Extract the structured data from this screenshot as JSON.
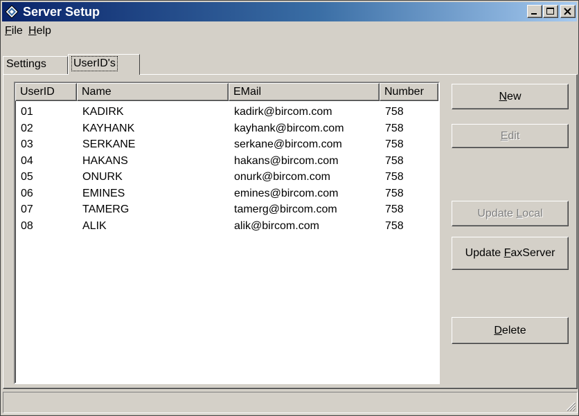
{
  "window": {
    "title": "Server Setup"
  },
  "titlebar_buttons": {
    "minimize": "minimize-icon",
    "maximize": "maximize-icon",
    "close": "close-icon"
  },
  "menu": [
    {
      "label": "File",
      "accel": "F",
      "rest": "ile"
    },
    {
      "label": "Help",
      "accel": "H",
      "rest": "elp"
    }
  ],
  "tabs": [
    {
      "label": "Settings",
      "selected": false
    },
    {
      "label": "UserID's",
      "selected": true
    }
  ],
  "table": {
    "columns": [
      "UserID",
      "Name",
      "EMail",
      "Number"
    ],
    "rows": [
      [
        "01",
        "KADIRK",
        "kadirk@bircom.com",
        "758"
      ],
      [
        "02",
        "KAYHANK",
        "kayhank@bircom.com",
        "758"
      ],
      [
        "03",
        "SERKANE",
        "serkane@bircom.com",
        "758"
      ],
      [
        "04",
        "HAKANS",
        "hakans@bircom.com",
        "758"
      ],
      [
        "05",
        "ONURK",
        "onurk@bircom.com",
        "758"
      ],
      [
        "06",
        "EMINES",
        "emines@bircom.com",
        "758"
      ],
      [
        "07",
        "TAMERG",
        "tamerg@bircom.com",
        "758"
      ],
      [
        "08",
        "ALIK",
        "alik@bircom.com",
        "758"
      ]
    ]
  },
  "buttons": {
    "new": {
      "pre": "",
      "accel": "N",
      "post": "ew",
      "enabled": true
    },
    "edit": {
      "pre": "",
      "accel": "E",
      "post": "dit",
      "enabled": false
    },
    "update_local": {
      "pre": "Update ",
      "accel": "L",
      "post": "ocal",
      "enabled": false
    },
    "update_faxserver": {
      "pre": "Update ",
      "accel": "F",
      "post": "axServer",
      "enabled": true
    },
    "delete": {
      "pre": "",
      "accel": "D",
      "post": "elete",
      "enabled": true
    }
  },
  "statusbar": {
    "text": ""
  },
  "colors": {
    "face": "#d4d0c8",
    "title_start": "#0a246a",
    "title_end": "#a6caf0",
    "disabled_text": "#808080"
  }
}
